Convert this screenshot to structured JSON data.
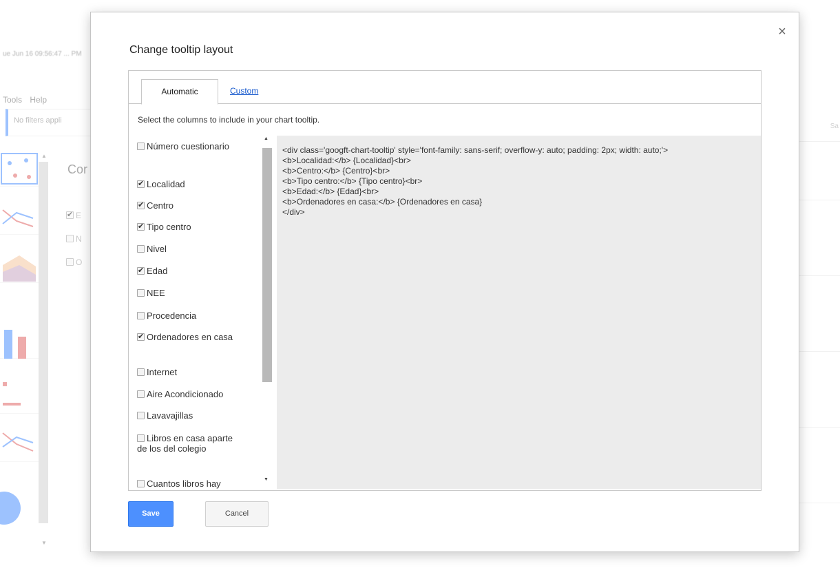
{
  "background": {
    "timestamp": "ue Jun 16 09:56:47 ... PM",
    "menu": [
      "Tools",
      "Help"
    ],
    "filter_text": "No filters appli",
    "heading": "Cor",
    "options": [
      "E",
      "N",
      "O"
    ],
    "right_text": "Sa"
  },
  "dialog": {
    "title": "Change tooltip layout",
    "close_glyph": "×",
    "tabs": {
      "automatic": "Automatic",
      "custom": "Custom"
    },
    "instruction": "Select the columns to include in your chart tooltip.",
    "columns": [
      {
        "label": "Número cuestionario",
        "checked": false
      },
      {
        "label": "Localidad",
        "checked": true
      },
      {
        "label": "Centro",
        "checked": true
      },
      {
        "label": "Tipo centro",
        "checked": true
      },
      {
        "label": "Nivel",
        "checked": false
      },
      {
        "label": "Edad",
        "checked": true
      },
      {
        "label": "NEE",
        "checked": false
      },
      {
        "label": "Procedencia",
        "checked": false
      },
      {
        "label": "Ordenadores en casa",
        "checked": true
      },
      {
        "label": "Internet",
        "checked": false
      },
      {
        "label": "Aire Acondicionado",
        "checked": false
      },
      {
        "label": "Lavavajillas",
        "checked": false
      },
      {
        "label": "Libros en casa aparte de los del colegio",
        "checked": false
      },
      {
        "label": "Cuantos libros hay",
        "checked": false
      }
    ],
    "code": "<div class='googft-chart-tooltip' style='font-family: sans-serif; overflow-y: auto; padding: 2px; width: auto;'>\n<b>Localidad:</b> {Localidad}<br>\n<b>Centro:</b> {Centro}<br>\n<b>Tipo centro:</b> {Tipo centro}<br>\n<b>Edad:</b> {Edad}<br>\n<b>Ordenadores en casa:</b> {Ordenadores en casa}\n</div>",
    "save_label": "Save",
    "cancel_label": "Cancel"
  },
  "colors": {
    "accent": "#4d90fe",
    "link": "#1155cc",
    "code_bg": "#ececec"
  }
}
